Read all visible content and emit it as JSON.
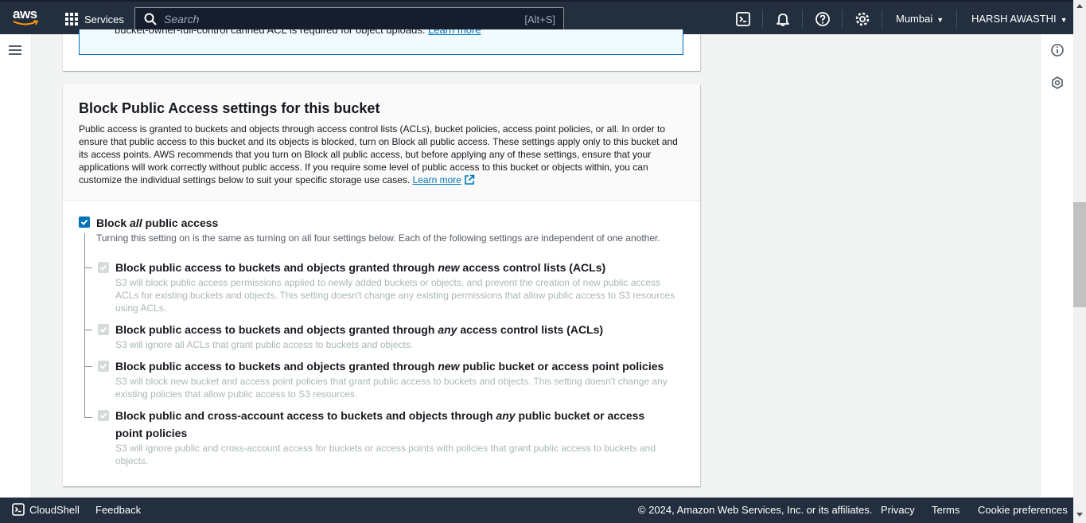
{
  "nav": {
    "logo_text": "aws",
    "services_label": "Services",
    "search_placeholder": "Search",
    "search_shortcut": "[Alt+S]",
    "region": "Mumbai",
    "user": "HARSH AWASTHI",
    "icons": [
      "cloudshell-icon",
      "bell-icon",
      "help-icon",
      "gear-icon"
    ]
  },
  "info_box": {
    "text_cut": "bucket-owner-full-control canned ACL is required for object uploads.",
    "link": "Learn more"
  },
  "bpa": {
    "title": "Block Public Access settings for this bucket",
    "intro": "Public access is granted to buckets and objects through access control lists (ACLs), bucket policies, access point policies, or all. In order to ensure that public access to this bucket and its objects is blocked, turn on Block all public access. These settings apply only to this bucket and its access points. AWS recommends that you turn on Block all public access, but before applying any of these settings, ensure that your applications will work correctly without public access. If you require some level of public access to this bucket or objects within, you can customize the individual settings below to suit your specific storage use cases.",
    "learn_more": "Learn more",
    "block_all": {
      "label_pre": "Block ",
      "label_em": "all",
      "label_post": " public access",
      "desc": "Turning this setting on is the same as turning on all four settings below. Each of the following settings are independent of one another.",
      "checked": true
    },
    "settings": [
      {
        "label_pre": "Block public access to buckets and objects granted through ",
        "label_em": "new",
        "label_post": " access control lists (ACLs)",
        "desc": "S3 will block public access permissions applied to newly added buckets or objects, and prevent the creation of new public access ACLs for existing buckets and objects. This setting doesn't change any existing permissions that allow public access to S3 resources using ACLs.",
        "checked": true
      },
      {
        "label_pre": "Block public access to buckets and objects granted through ",
        "label_em": "any",
        "label_post": " access control lists (ACLs)",
        "desc": "S3 will ignore all ACLs that grant public access to buckets and objects.",
        "checked": true
      },
      {
        "label_pre": "Block public access to buckets and objects granted through ",
        "label_em": "new",
        "label_post": " public bucket or access point policies",
        "desc": "S3 will block new bucket and access point policies that grant public access to buckets and objects. This setting doesn't change any existing policies that allow public access to S3 resources.",
        "checked": true
      },
      {
        "label_pre": "Block public and cross-account access to buckets and objects through ",
        "label_em": "any",
        "label_post": " public bucket or access point policies",
        "desc": "S3 will ignore public and cross-account access for buckets or access points with policies that grant public access to buckets and objects.",
        "checked": true
      }
    ]
  },
  "footer": {
    "cloudshell": "CloudShell",
    "feedback": "Feedback",
    "copyright": "© 2024, Amazon Web Services, Inc. or its affiliates.",
    "privacy": "Privacy",
    "terms": "Terms",
    "cookies": "Cookie preferences"
  },
  "colors": {
    "nav_bg": "#232f3e",
    "link": "#0073bb",
    "checkbox_on": "#0073bb",
    "checkbox_disabled": "#d5dbdb"
  }
}
